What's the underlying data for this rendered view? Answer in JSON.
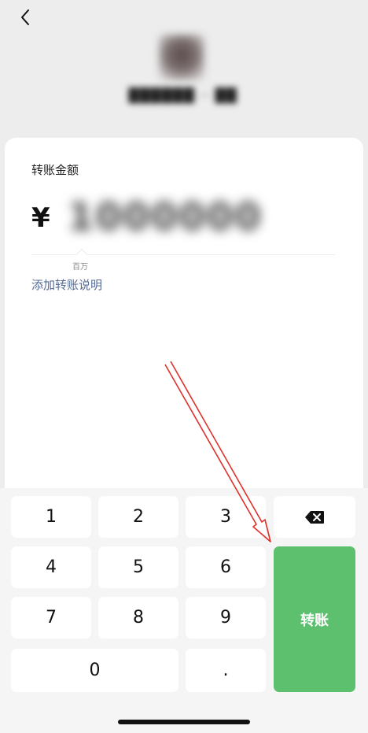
{
  "header": {
    "back_icon": "chevron-left-icon"
  },
  "recipient": {
    "name": "██████ ·· ██"
  },
  "transfer": {
    "amount_label": "转账金额",
    "currency_symbol": "¥",
    "amount_value": "1000000",
    "unit_hint": "百万",
    "add_note_label": "添加转账说明"
  },
  "keypad": {
    "keys": [
      "1",
      "2",
      "3",
      "4",
      "5",
      "6",
      "7",
      "8",
      "9",
      "0",
      "."
    ],
    "delete_icon": "backspace-icon",
    "submit_label": "转账",
    "submit_color": "#5dc06f"
  },
  "colors": {
    "link": "#576b95",
    "arrow": "#e0302b"
  }
}
